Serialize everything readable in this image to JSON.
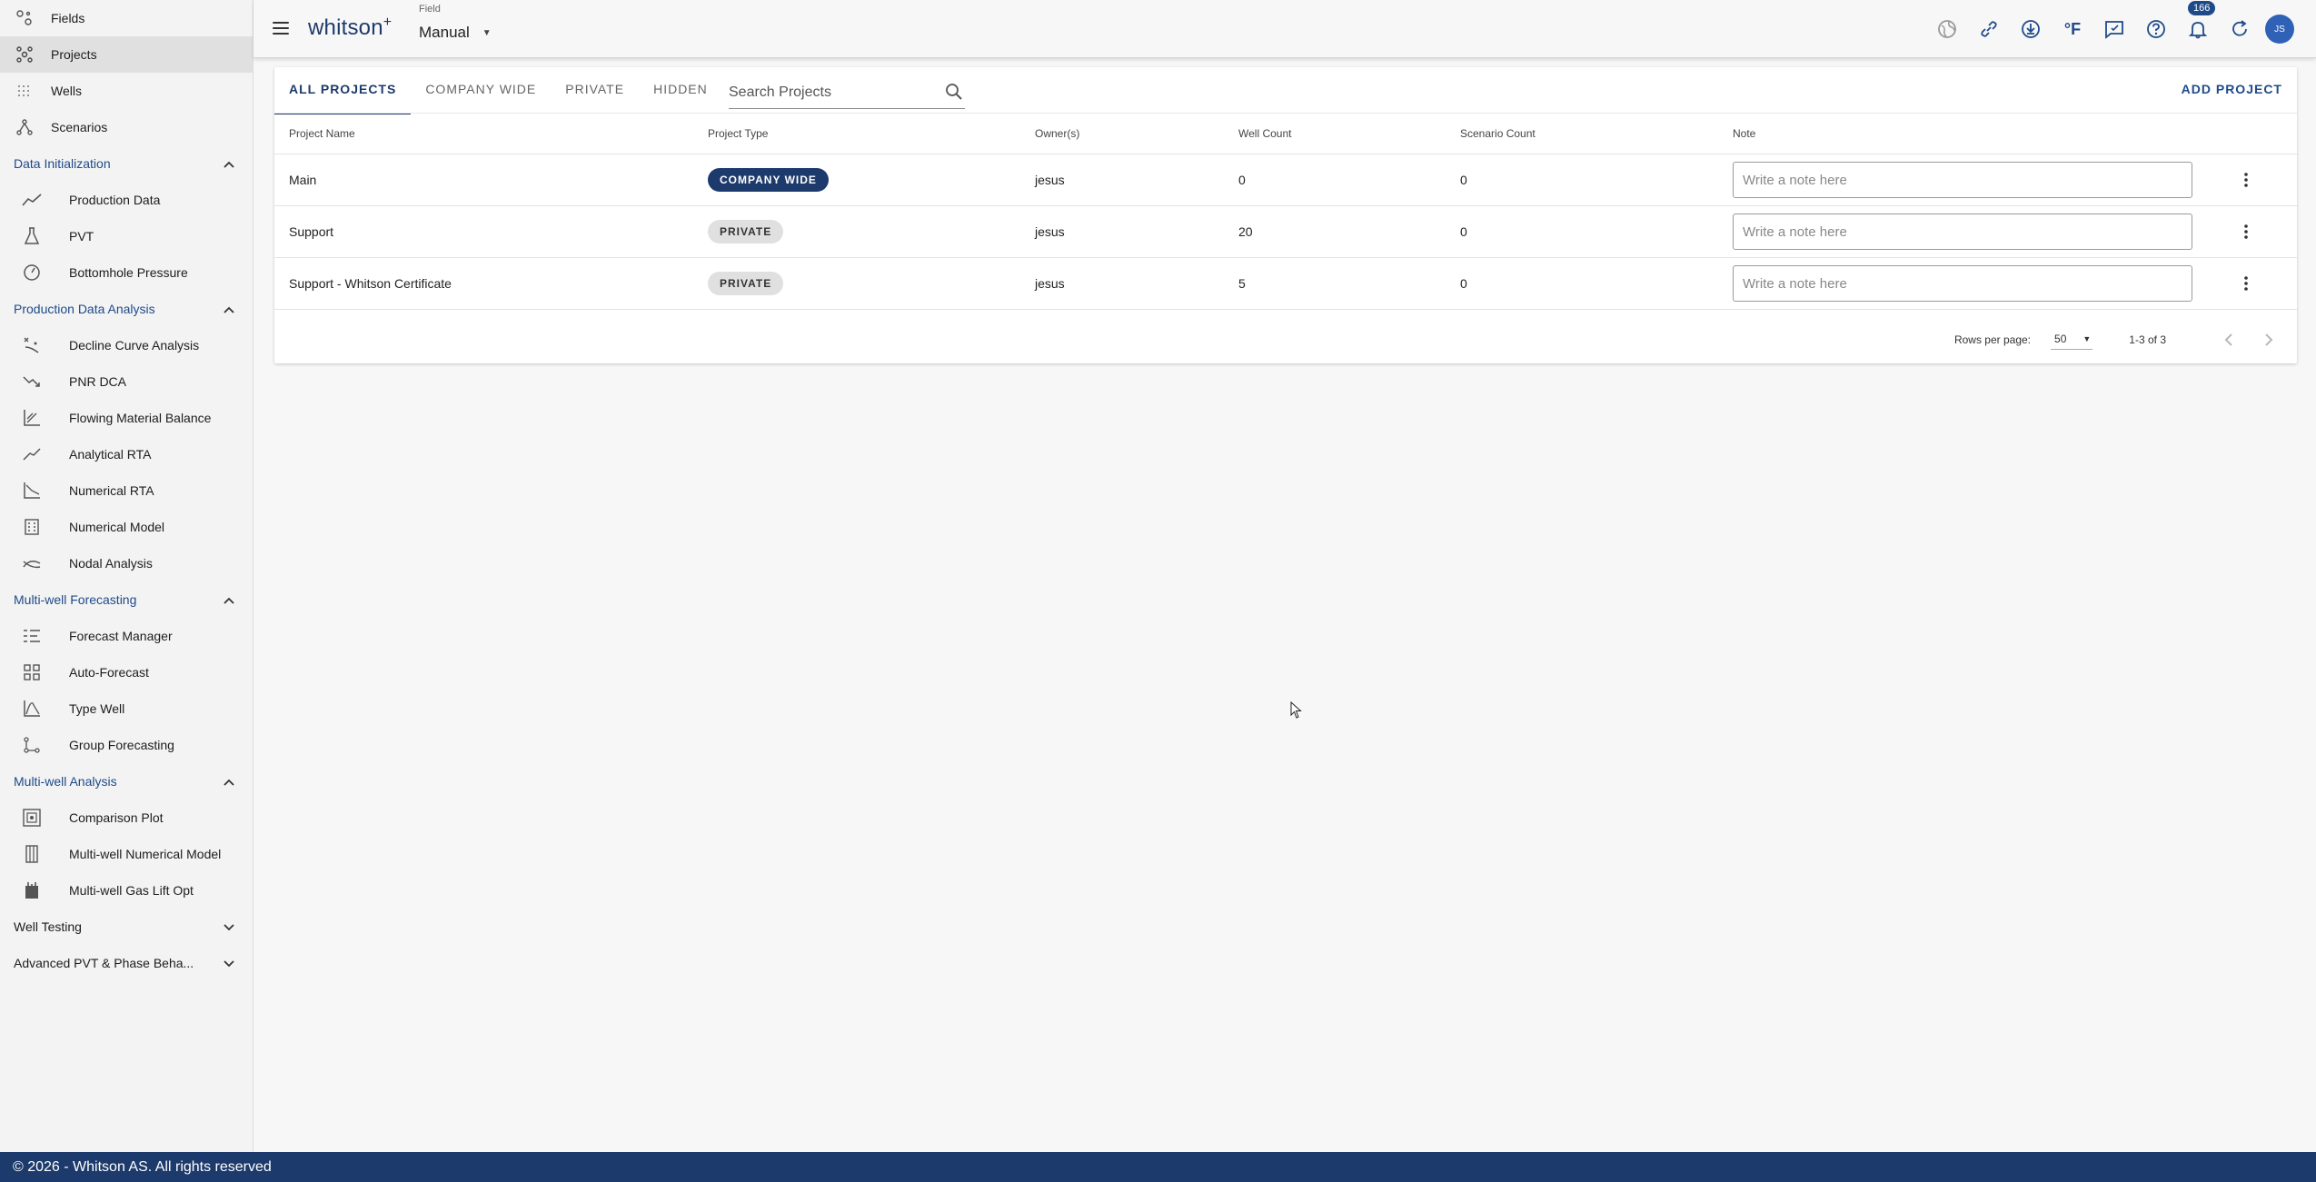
{
  "sidebar": {
    "top_items": [
      {
        "label": "Fields",
        "icon": "fields-icon"
      },
      {
        "label": "Projects",
        "icon": "projects-icon",
        "active": true
      },
      {
        "label": "Wells",
        "icon": "wells-icon"
      },
      {
        "label": "Scenarios",
        "icon": "scenarios-icon"
      }
    ],
    "sections": [
      {
        "title": "Data Initialization",
        "expanded": true,
        "items": [
          {
            "label": "Production Data",
            "icon": "line-chart-icon"
          },
          {
            "label": "PVT",
            "icon": "flask-icon"
          },
          {
            "label": "Bottomhole Pressure",
            "icon": "gauge-icon"
          }
        ]
      },
      {
        "title": "Production Data Analysis",
        "expanded": true,
        "items": [
          {
            "label": "Decline Curve Analysis",
            "icon": "decline-curve-icon"
          },
          {
            "label": "PNR DCA",
            "icon": "trending-down-icon"
          },
          {
            "label": "Flowing Material Balance",
            "icon": "material-balance-icon"
          },
          {
            "label": "Analytical RTA",
            "icon": "analytical-rta-icon"
          },
          {
            "label": "Numerical RTA",
            "icon": "numerical-rta-icon"
          },
          {
            "label": "Numerical Model",
            "icon": "building-icon"
          },
          {
            "label": "Nodal Analysis",
            "icon": "nodal-icon"
          }
        ]
      },
      {
        "title": "Multi-well Forecasting",
        "expanded": true,
        "items": [
          {
            "label": "Forecast Manager",
            "icon": "list-icon"
          },
          {
            "label": "Auto-Forecast",
            "icon": "grid-icon"
          },
          {
            "label": "Type Well",
            "icon": "type-well-icon"
          },
          {
            "label": "Group Forecasting",
            "icon": "group-forecast-icon"
          }
        ]
      },
      {
        "title": "Multi-well Analysis",
        "expanded": true,
        "items": [
          {
            "label": "Comparison Plot",
            "icon": "comparison-icon"
          },
          {
            "label": "Multi-well Numerical Model",
            "icon": "columns-icon"
          },
          {
            "label": "Multi-well Gas Lift Opt",
            "icon": "gas-lift-icon"
          }
        ]
      },
      {
        "title": "Well Testing",
        "expanded": false,
        "items": []
      },
      {
        "title": "Advanced PVT & Phase Beha...",
        "expanded": false,
        "items": []
      }
    ]
  },
  "topbar": {
    "logo": "whitson",
    "logo_sup": "+",
    "field_label": "Field",
    "field_value": "Manual",
    "notification_count": "166",
    "avatar_initials": "JS",
    "unit_label": "°F"
  },
  "tabs": [
    "ALL PROJECTS",
    "COMPANY WIDE",
    "PRIVATE",
    "HIDDEN"
  ],
  "active_tab": "ALL PROJECTS",
  "search": {
    "placeholder": "Search Projects",
    "value": ""
  },
  "add_project_label": "ADD PROJECT",
  "table": {
    "columns": [
      "Project Name",
      "Project Type",
      "Owner(s)",
      "Well Count",
      "Scenario Count",
      "Note"
    ],
    "rows": [
      {
        "name": "Main",
        "type": "COMPANY WIDE",
        "type_style": "dark",
        "owner": "jesus",
        "wells": "0",
        "scenarios": "0",
        "note_placeholder": "Write a note here"
      },
      {
        "name": "Support",
        "type": "PRIVATE",
        "type_style": "light",
        "owner": "jesus",
        "wells": "20",
        "scenarios": "0",
        "note_placeholder": "Write a note here"
      },
      {
        "name": "Support - Whitson Certificate",
        "type": "PRIVATE",
        "type_style": "light",
        "owner": "jesus",
        "wells": "5",
        "scenarios": "0",
        "note_placeholder": "Write a note here"
      }
    ]
  },
  "pagination": {
    "rows_per_page_label": "Rows per page:",
    "rows_per_page": "50",
    "range": "1-3 of 3"
  },
  "footer": {
    "text": "© 2026 - Whitson AS. All rights reserved"
  },
  "colors": {
    "brand": "#1c3a6b",
    "accent": "#1f4a8a",
    "footer": "#1c3a6b"
  }
}
